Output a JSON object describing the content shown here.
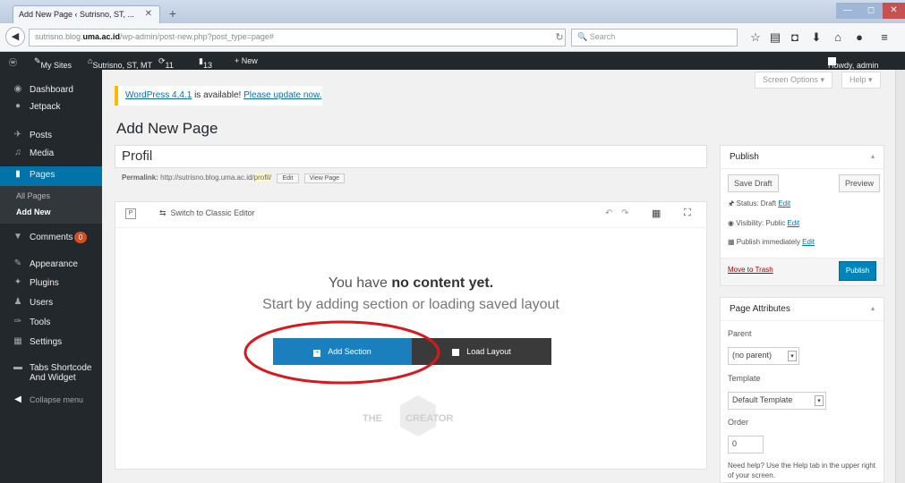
{
  "browser": {
    "tab_title": "Add New Page ‹ Sutrisno, ST, ...",
    "tab_close": "✕",
    "new_tab": "+",
    "url_host": "sutrisno.blog.",
    "url_domain": "uma.ac.id",
    "url_path": "/wp-admin/post-new.php?post_type=page#",
    "search_placeholder": "Search",
    "window_buttons": [
      "—",
      "◻",
      "✕"
    ]
  },
  "adminbar": {
    "my_sites": "My Sites",
    "site_name": "Sutrisno, ST, MT",
    "updates": "11",
    "comments": "13",
    "new": "+ New",
    "howdy": "Howdy, admin"
  },
  "sidebar": {
    "items": [
      {
        "label": "Dashboard",
        "icon": "dashboard-icon"
      },
      {
        "label": "Jetpack",
        "icon": "jetpack-icon"
      },
      {
        "label": "Posts",
        "icon": "pin-icon"
      },
      {
        "label": "Media",
        "icon": "media-icon"
      },
      {
        "label": "Pages",
        "icon": "pages-icon"
      },
      {
        "label": "Comments",
        "icon": "comment-icon"
      },
      {
        "label": "Appearance",
        "icon": "brush-icon"
      },
      {
        "label": "Plugins",
        "icon": "plugin-icon"
      },
      {
        "label": "Users",
        "icon": "users-icon"
      },
      {
        "label": "Tools",
        "icon": "wrench-icon"
      },
      {
        "label": "Settings",
        "icon": "settings-icon"
      },
      {
        "label": "Tabs Shortcode And Widget",
        "icon": "tabs-icon"
      },
      {
        "label": "Collapse menu",
        "icon": "collapse-icon"
      }
    ],
    "pages_sub": [
      "All Pages",
      "Add New"
    ],
    "comments_badge": "0"
  },
  "screen_options": "Screen Options ▾",
  "help": "Help ▾",
  "notice": {
    "prefix": "WordPress 4.4.1",
    "middle": " is available! ",
    "link": "Please update now."
  },
  "page_title": "Add New Page",
  "title_value": "Profil",
  "permalink": {
    "label": "Permalink:",
    "base": "http://sutrisno.blog.uma.ac.id/",
    "slug": "profil/",
    "edit": "Edit",
    "view": "View Page"
  },
  "editor": {
    "switch_label": "Switch to Classic Editor",
    "empty_prefix": "You have ",
    "empty_bold": "no content yet.",
    "empty_line2": "Start by adding section or loading saved layout",
    "add_section": "Add Section",
    "load_layout": "Load Layout",
    "watermark_left": "THE",
    "watermark_right": "CREATOR"
  },
  "publish": {
    "title": "Publish",
    "save_draft": "Save Draft",
    "preview": "Preview",
    "status": "Status: Draft",
    "visibility": "Visibility: Public",
    "schedule": "Publish immediately",
    "edit": "Edit",
    "trash": "Move to Trash",
    "publish": "Publish"
  },
  "page_attributes": {
    "title": "Page Attributes",
    "parent_label": "Parent",
    "parent_value": "(no parent)",
    "template_label": "Template",
    "template_value": "Default Template",
    "order_label": "Order",
    "order_value": "0",
    "help_text": "Need help? Use the Help tab in the upper right of your screen."
  },
  "colors": {
    "admin_dark": "#23282d",
    "accent": "#0073aa",
    "add_section": "#1a7fbc",
    "load_layout": "#3a3a3a",
    "annotation": "#d9181e"
  }
}
